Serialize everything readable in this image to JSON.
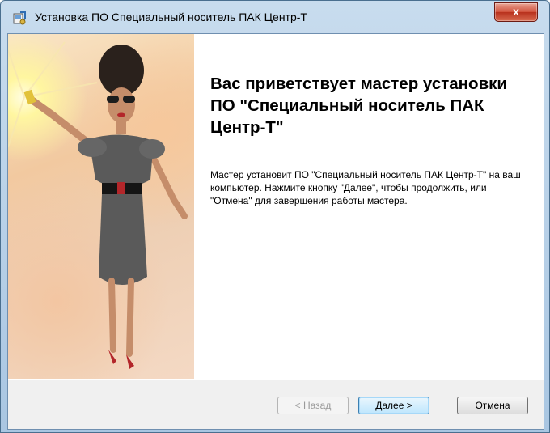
{
  "window": {
    "title": "Установка ПО Специальный носитель ПАК Центр-Т",
    "close_glyph": "x"
  },
  "content": {
    "welcome_heading": "Вас приветствует мастер установки ПО \"Специальный носитель ПАК Центр-Т\"",
    "description": "Мастер установит ПО \"Специальный носитель ПАК Центр-Т\" на ваш компьютер. Нажмите кнопку \"Далее\", чтобы продолжить, или \"Отмена\" для завершения работы мастера."
  },
  "buttons": {
    "back_label": "< Назад",
    "next_label": "Далее >",
    "cancel_label": "Отмена"
  },
  "icons": {
    "app": "installer-icon",
    "close": "close-icon"
  },
  "colors": {
    "title_bar": "#b9d1ea",
    "close_button": "#c9472f",
    "next_button_border": "#3c7fb1"
  }
}
